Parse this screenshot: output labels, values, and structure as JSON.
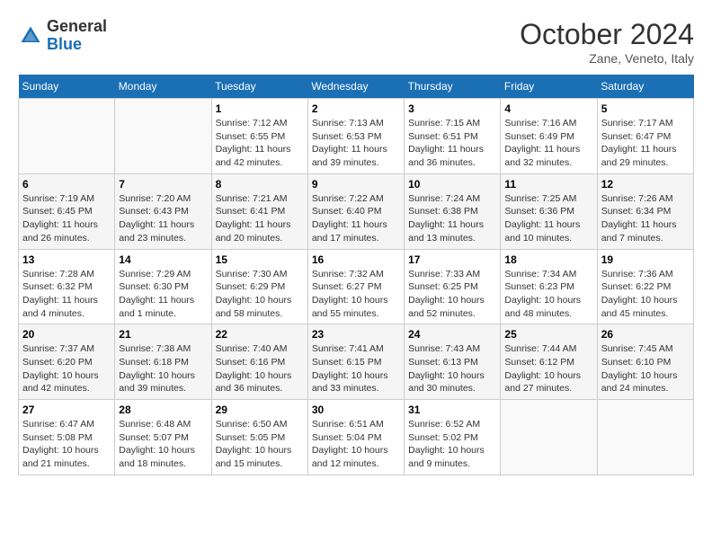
{
  "header": {
    "logo_general": "General",
    "logo_blue": "Blue",
    "month": "October 2024",
    "location": "Zane, Veneto, Italy"
  },
  "days_of_week": [
    "Sunday",
    "Monday",
    "Tuesday",
    "Wednesday",
    "Thursday",
    "Friday",
    "Saturday"
  ],
  "weeks": [
    [
      {
        "day": "",
        "content": ""
      },
      {
        "day": "",
        "content": ""
      },
      {
        "day": "1",
        "content": "Sunrise: 7:12 AM\nSunset: 6:55 PM\nDaylight: 11 hours and 42 minutes."
      },
      {
        "day": "2",
        "content": "Sunrise: 7:13 AM\nSunset: 6:53 PM\nDaylight: 11 hours and 39 minutes."
      },
      {
        "day": "3",
        "content": "Sunrise: 7:15 AM\nSunset: 6:51 PM\nDaylight: 11 hours and 36 minutes."
      },
      {
        "day": "4",
        "content": "Sunrise: 7:16 AM\nSunset: 6:49 PM\nDaylight: 11 hours and 32 minutes."
      },
      {
        "day": "5",
        "content": "Sunrise: 7:17 AM\nSunset: 6:47 PM\nDaylight: 11 hours and 29 minutes."
      }
    ],
    [
      {
        "day": "6",
        "content": "Sunrise: 7:19 AM\nSunset: 6:45 PM\nDaylight: 11 hours and 26 minutes."
      },
      {
        "day": "7",
        "content": "Sunrise: 7:20 AM\nSunset: 6:43 PM\nDaylight: 11 hours and 23 minutes."
      },
      {
        "day": "8",
        "content": "Sunrise: 7:21 AM\nSunset: 6:41 PM\nDaylight: 11 hours and 20 minutes."
      },
      {
        "day": "9",
        "content": "Sunrise: 7:22 AM\nSunset: 6:40 PM\nDaylight: 11 hours and 17 minutes."
      },
      {
        "day": "10",
        "content": "Sunrise: 7:24 AM\nSunset: 6:38 PM\nDaylight: 11 hours and 13 minutes."
      },
      {
        "day": "11",
        "content": "Sunrise: 7:25 AM\nSunset: 6:36 PM\nDaylight: 11 hours and 10 minutes."
      },
      {
        "day": "12",
        "content": "Sunrise: 7:26 AM\nSunset: 6:34 PM\nDaylight: 11 hours and 7 minutes."
      }
    ],
    [
      {
        "day": "13",
        "content": "Sunrise: 7:28 AM\nSunset: 6:32 PM\nDaylight: 11 hours and 4 minutes."
      },
      {
        "day": "14",
        "content": "Sunrise: 7:29 AM\nSunset: 6:30 PM\nDaylight: 11 hours and 1 minute."
      },
      {
        "day": "15",
        "content": "Sunrise: 7:30 AM\nSunset: 6:29 PM\nDaylight: 10 hours and 58 minutes."
      },
      {
        "day": "16",
        "content": "Sunrise: 7:32 AM\nSunset: 6:27 PM\nDaylight: 10 hours and 55 minutes."
      },
      {
        "day": "17",
        "content": "Sunrise: 7:33 AM\nSunset: 6:25 PM\nDaylight: 10 hours and 52 minutes."
      },
      {
        "day": "18",
        "content": "Sunrise: 7:34 AM\nSunset: 6:23 PM\nDaylight: 10 hours and 48 minutes."
      },
      {
        "day": "19",
        "content": "Sunrise: 7:36 AM\nSunset: 6:22 PM\nDaylight: 10 hours and 45 minutes."
      }
    ],
    [
      {
        "day": "20",
        "content": "Sunrise: 7:37 AM\nSunset: 6:20 PM\nDaylight: 10 hours and 42 minutes."
      },
      {
        "day": "21",
        "content": "Sunrise: 7:38 AM\nSunset: 6:18 PM\nDaylight: 10 hours and 39 minutes."
      },
      {
        "day": "22",
        "content": "Sunrise: 7:40 AM\nSunset: 6:16 PM\nDaylight: 10 hours and 36 minutes."
      },
      {
        "day": "23",
        "content": "Sunrise: 7:41 AM\nSunset: 6:15 PM\nDaylight: 10 hours and 33 minutes."
      },
      {
        "day": "24",
        "content": "Sunrise: 7:43 AM\nSunset: 6:13 PM\nDaylight: 10 hours and 30 minutes."
      },
      {
        "day": "25",
        "content": "Sunrise: 7:44 AM\nSunset: 6:12 PM\nDaylight: 10 hours and 27 minutes."
      },
      {
        "day": "26",
        "content": "Sunrise: 7:45 AM\nSunset: 6:10 PM\nDaylight: 10 hours and 24 minutes."
      }
    ],
    [
      {
        "day": "27",
        "content": "Sunrise: 6:47 AM\nSunset: 5:08 PM\nDaylight: 10 hours and 21 minutes."
      },
      {
        "day": "28",
        "content": "Sunrise: 6:48 AM\nSunset: 5:07 PM\nDaylight: 10 hours and 18 minutes."
      },
      {
        "day": "29",
        "content": "Sunrise: 6:50 AM\nSunset: 5:05 PM\nDaylight: 10 hours and 15 minutes."
      },
      {
        "day": "30",
        "content": "Sunrise: 6:51 AM\nSunset: 5:04 PM\nDaylight: 10 hours and 12 minutes."
      },
      {
        "day": "31",
        "content": "Sunrise: 6:52 AM\nSunset: 5:02 PM\nDaylight: 10 hours and 9 minutes."
      },
      {
        "day": "",
        "content": ""
      },
      {
        "day": "",
        "content": ""
      }
    ]
  ]
}
